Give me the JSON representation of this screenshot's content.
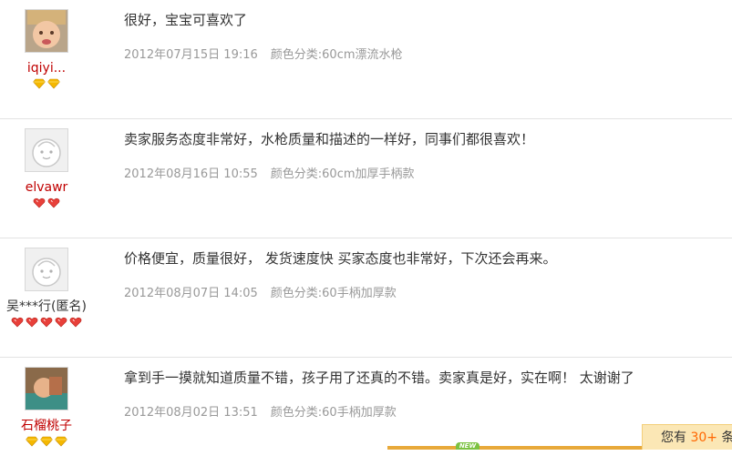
{
  "reviews": [
    {
      "user": "iqiyi...",
      "avatar": "baby-photo-avatar",
      "gem_icon": "gold-diamond-icon",
      "gem_count": 2,
      "text": "很好，宝宝可喜欢了",
      "date": "2012年07月15日 19:16",
      "sku": "颜色分类:60cm漂流水枪"
    },
    {
      "user": "elvawr",
      "avatar": "default-face-avatar",
      "gem_icon": "red-heart-icon",
      "gem_count": 2,
      "text": "卖家服务态度非常好，水枪质量和描述的一样好，同事们都很喜欢！",
      "date": "2012年08月16日 10:55",
      "sku": "颜色分类:60cm加厚手柄款"
    },
    {
      "user": "吴***行(匿名)",
      "avatar": "default-face-avatar",
      "gem_icon": "red-heart-icon",
      "gem_count": 5,
      "text": "价格便宜，质量很好，  发货速度快 买家态度也非常好，下次还会再来。",
      "date": "2012年08月07日 14:05",
      "sku": "颜色分类:60手柄加厚款"
    },
    {
      "user": "石榴桃子",
      "avatar": "child-photo-avatar",
      "gem_icon": "gold-diamond-icon",
      "gem_count": 3,
      "text": "拿到手一摸就知道质量不错，孩子用了还真的不错。卖家真是好，实在啊！ 太谢谢了",
      "date": "2012年08月02日 13:51",
      "sku": "颜色分类:60手柄加厚款"
    }
  ],
  "total_bar": {
    "prefix": "您有",
    "count": "30+",
    "suffix": "条新"
  },
  "badge": "NEW",
  "colors": {
    "username": "#c00000",
    "meta": "#999999",
    "accent": "#ff6600",
    "gold_gem": "#f5b800",
    "red_gem": "#e8403a"
  }
}
